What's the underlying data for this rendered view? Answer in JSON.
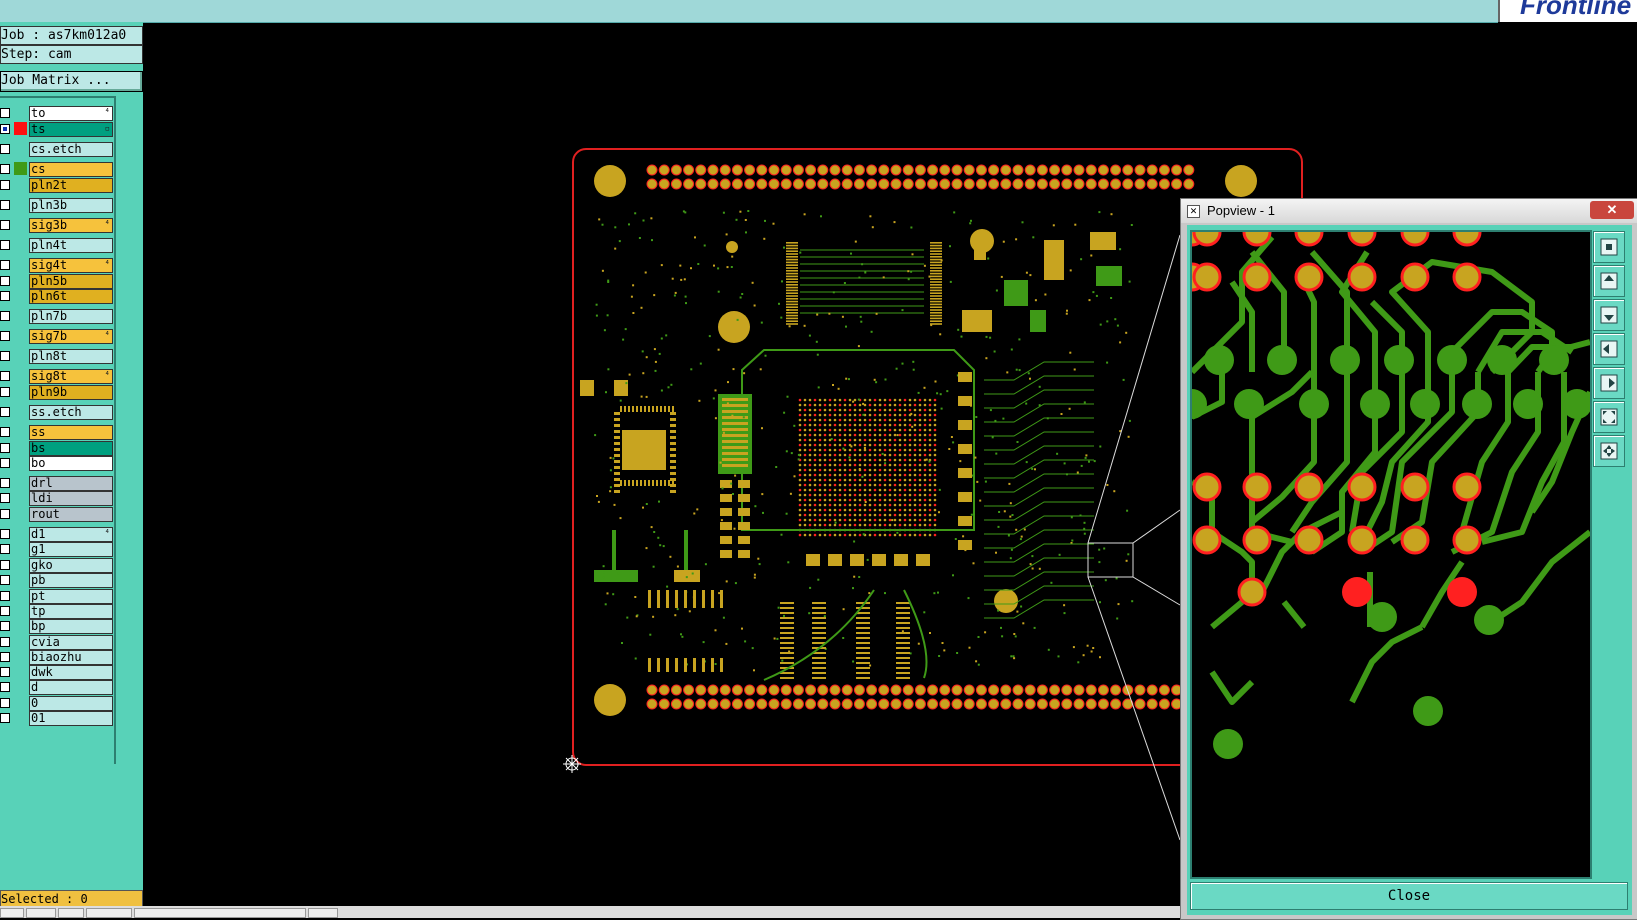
{
  "brand": "Frontline",
  "job_label": "Job : as7km012a0",
  "step_label": "Step: cam",
  "job_matrix_label": "Job Matrix ...",
  "selected_label": "Selected : 0",
  "colors": {
    "panel_bg": "#58d2b8",
    "copper_pad": "#c8a420",
    "copper_trace": "#3f9a17",
    "pad_ring": "#ff2020",
    "board_outline": "#e02020"
  },
  "layers": [
    {
      "name": "to",
      "bg": "#ffffff",
      "swatch": "",
      "flag": "⁴"
    },
    {
      "name": "ts",
      "bg": "#00a080",
      "swatch": "#ff1010",
      "flag": "▫",
      "checked": true
    },
    {
      "name": "cs.etch",
      "bg": "#bce8e6",
      "swatch": "",
      "flag": ""
    },
    {
      "name": "cs",
      "bg": "#f6c23c",
      "swatch": "#3f9a17",
      "flag": ""
    },
    {
      "name": "pln2t",
      "bg": "#e0b020",
      "swatch": "",
      "flag": ""
    },
    {
      "name": "pln3b",
      "bg": "#bce8e6",
      "swatch": "",
      "flag": ""
    },
    {
      "name": "sig3b",
      "bg": "#f6c23c",
      "swatch": "",
      "flag": "⁴"
    },
    {
      "name": "pln4t",
      "bg": "#bce8e6",
      "swatch": "",
      "flag": ""
    },
    {
      "name": "sig4t",
      "bg": "#f6c23c",
      "swatch": "",
      "flag": "⁴"
    },
    {
      "name": "pln5b",
      "bg": "#e0b020",
      "swatch": "",
      "flag": ""
    },
    {
      "name": "pln6t",
      "bg": "#e0b020",
      "swatch": "",
      "flag": ""
    },
    {
      "name": "pln7b",
      "bg": "#bce8e6",
      "swatch": "",
      "flag": ""
    },
    {
      "name": "sig7b",
      "bg": "#f6c23c",
      "swatch": "",
      "flag": "⁴"
    },
    {
      "name": "pln8t",
      "bg": "#bce8e6",
      "swatch": "",
      "flag": ""
    },
    {
      "name": "sig8t",
      "bg": "#f6c23c",
      "swatch": "",
      "flag": "⁴"
    },
    {
      "name": "pln9b",
      "bg": "#e0b020",
      "swatch": "",
      "flag": ""
    },
    {
      "name": "ss.etch",
      "bg": "#bce8e6",
      "swatch": "",
      "flag": ""
    },
    {
      "name": "ss",
      "bg": "#f6c23c",
      "swatch": "",
      "flag": ""
    },
    {
      "name": "bs",
      "bg": "#00a080",
      "swatch": "",
      "flag": ""
    },
    {
      "name": "bo",
      "bg": "#ffffff",
      "swatch": "",
      "flag": ""
    },
    {
      "name": "drl",
      "bg": "#b8c4cc",
      "swatch": "",
      "flag": ""
    },
    {
      "name": "ldi",
      "bg": "#b8c4cc",
      "swatch": "",
      "flag": ""
    },
    {
      "name": "rout",
      "bg": "#b8c4cc",
      "swatch": "",
      "flag": ""
    },
    {
      "name": "d1",
      "bg": "#bce8e6",
      "swatch": "",
      "flag": "⁴"
    },
    {
      "name": "g1",
      "bg": "#bce8e6",
      "swatch": "",
      "flag": ""
    },
    {
      "name": "gko",
      "bg": "#bce8e6",
      "swatch": "",
      "flag": ""
    },
    {
      "name": "pb",
      "bg": "#bce8e6",
      "swatch": "",
      "flag": ""
    },
    {
      "name": "pt",
      "bg": "#bce8e6",
      "swatch": "",
      "flag": ""
    },
    {
      "name": "tp",
      "bg": "#bce8e6",
      "swatch": "",
      "flag": ""
    },
    {
      "name": "bp",
      "bg": "#bce8e6",
      "swatch": "",
      "flag": ""
    },
    {
      "name": "cvia",
      "bg": "#bce8e6",
      "swatch": "",
      "flag": ""
    },
    {
      "name": "biaozhu",
      "bg": "#bce8e6",
      "swatch": "",
      "flag": ""
    },
    {
      "name": "dwk",
      "bg": "#bce8e6",
      "swatch": "",
      "flag": ""
    },
    {
      "name": "d",
      "bg": "#bce8e6",
      "swatch": "",
      "flag": ""
    },
    {
      "name": "0",
      "bg": "#bce8e6",
      "swatch": "",
      "flag": ""
    },
    {
      "name": "01",
      "bg": "#bce8e6",
      "swatch": "",
      "flag": ""
    }
  ],
  "popview": {
    "title": "Popview - 1",
    "close_x": "✕",
    "close_button": "Close",
    "tools": [
      "zoom-fit-icon",
      "pan-up-icon",
      "pan-down-icon",
      "pan-left-icon",
      "pan-right-icon",
      "zoom-in-icon",
      "zoom-out-icon"
    ]
  }
}
